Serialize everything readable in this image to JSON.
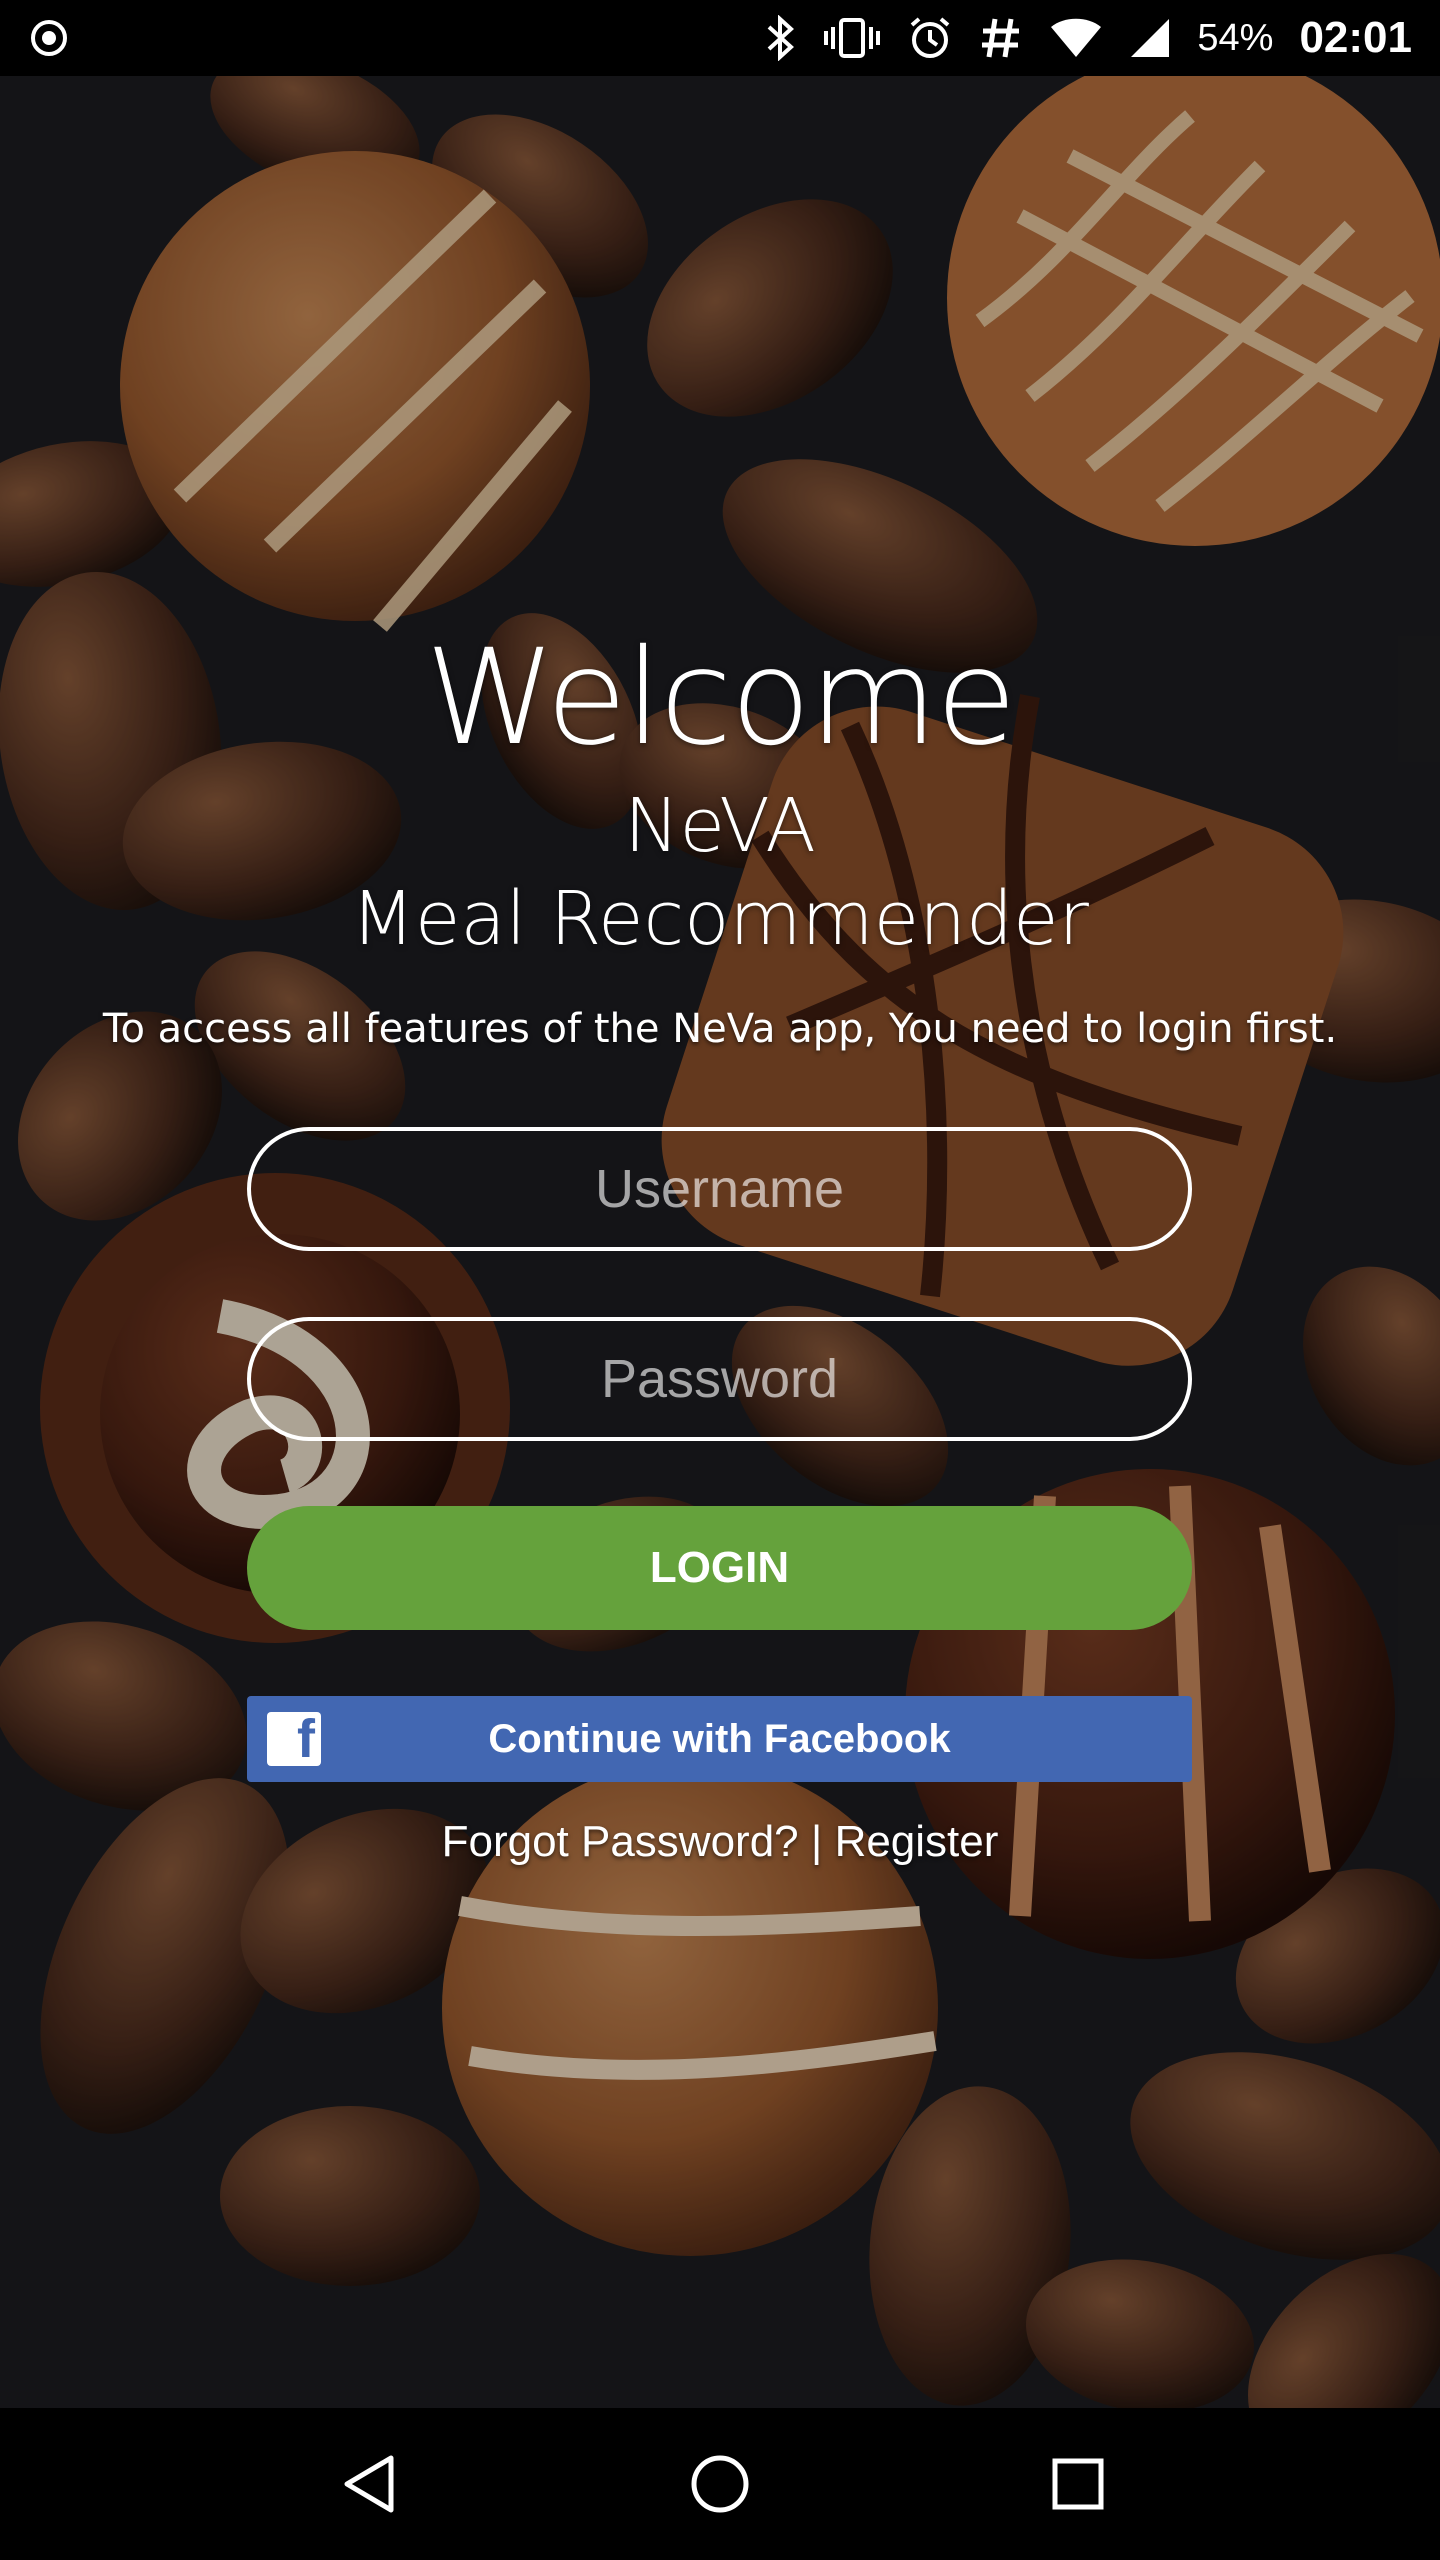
{
  "status_bar": {
    "left_icon": "record-circle-icon",
    "icons": [
      "bluetooth-icon",
      "vibrate-icon",
      "alarm-icon",
      "hashtag-icon",
      "wifi-icon",
      "signal-icon"
    ],
    "battery": "54%",
    "time": "02:01"
  },
  "login_screen": {
    "welcome": "Welcome",
    "app_name": "NeVA",
    "app_subtitle": "Meal Recommender",
    "intro": "To access all features of the NeVa app, You need to login first.",
    "username_placeholder": "Username",
    "password_placeholder": "Password",
    "login_label": "LOGIN",
    "facebook_label": "Continue with Facebook",
    "forgot_password": "Forgot Password?",
    "separator": "|",
    "register": "Register"
  },
  "colors": {
    "login_button": "#65a23c",
    "facebook_button": "#4267b2",
    "status_bar": "#000000"
  },
  "nav_bar": {
    "items": [
      "back-icon",
      "home-icon",
      "recents-icon"
    ]
  }
}
